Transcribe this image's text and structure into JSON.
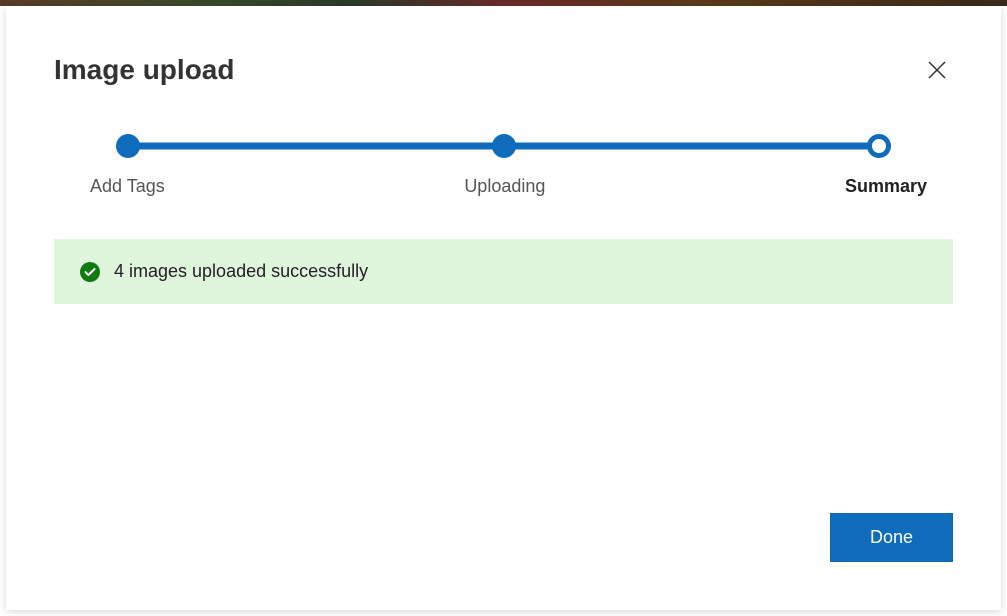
{
  "dialog": {
    "title": "Image upload"
  },
  "stepper": {
    "steps": [
      {
        "label": "Add Tags",
        "state": "done"
      },
      {
        "label": "Uploading",
        "state": "done"
      },
      {
        "label": "Summary",
        "state": "current"
      }
    ]
  },
  "status": {
    "icon": "checkmark-circle",
    "message": "4 images uploaded successfully",
    "kind": "success",
    "bg_color": "#dff6dd",
    "icon_color": "#107c10"
  },
  "footer": {
    "done_label": "Done"
  },
  "colors": {
    "accent": "#0f6cbd"
  }
}
